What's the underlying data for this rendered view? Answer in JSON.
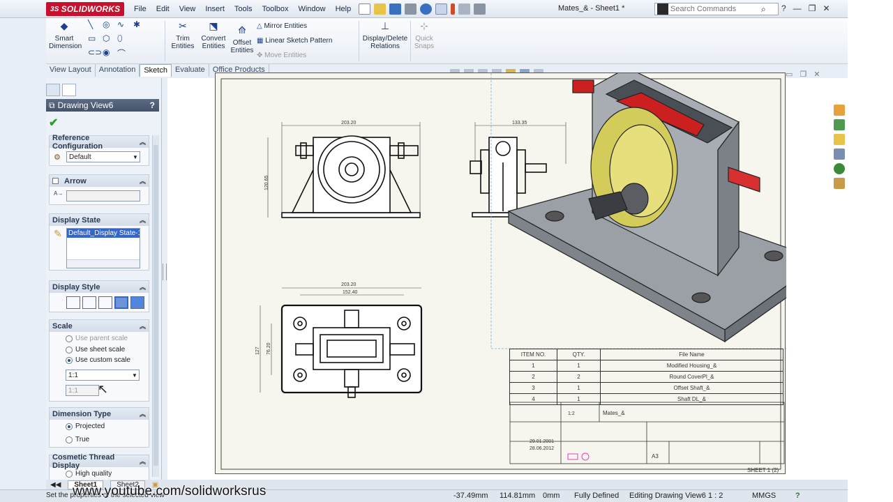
{
  "app": {
    "name": "SOLIDWORKS",
    "document_title": "Mates_& - Sheet1 *",
    "menu": [
      "File",
      "Edit",
      "View",
      "Insert",
      "Tools",
      "Toolbox",
      "Window",
      "Help"
    ],
    "search_placeholder": "Search Commands"
  },
  "commands": {
    "smart_dimension": "Smart Dimension",
    "trim": "Trim Entities",
    "convert": "Convert Entities",
    "offset": "Offset Entities",
    "mirror": "Mirror Entities",
    "linear_pattern": "Linear Sketch Pattern",
    "move": "Move Entities",
    "display_relations": "Display/Delete Relations",
    "quick_snaps": "Quick Snaps"
  },
  "tabs": [
    "View Layout",
    "Annotation",
    "Sketch",
    "Evaluate",
    "Office Products"
  ],
  "active_tab": "Sketch",
  "property_manager": {
    "title": "Drawing View6",
    "help": "?",
    "reference_config": {
      "label": "Reference Configuration",
      "value": "Default"
    },
    "arrow": {
      "label": "Arrow"
    },
    "display_state": {
      "label": "Display State",
      "value": "Default_Display State-1"
    },
    "display_style": {
      "label": "Display Style"
    },
    "scale": {
      "label": "Scale",
      "options": [
        "Use parent scale",
        "Use sheet scale",
        "Use custom scale"
      ],
      "selected": "Use custom scale",
      "value": "1:1",
      "value2": "1:1"
    },
    "dimension_type": {
      "label": "Dimension Type",
      "options": [
        "Projected",
        "True"
      ],
      "selected": "Projected"
    },
    "cosmetic_thread": {
      "label": "Cosmetic Thread Display",
      "options": [
        "High quality"
      ]
    }
  },
  "drawing": {
    "dims": {
      "front_width": "203.20",
      "front_height": "120.65",
      "side_width": "133.35",
      "top_width": "203.20",
      "top_inner": "152.40",
      "top_height": "127",
      "top_inner_h": "76.20"
    },
    "bom": {
      "headers": [
        "ITEM NO.",
        "QTY.",
        "File Name"
      ],
      "rows": [
        [
          "1",
          "1",
          "Modified Housing_&"
        ],
        [
          "2",
          "2",
          "Round CoverPl_&"
        ],
        [
          "3",
          "1",
          "Offset Shaft_&"
        ],
        [
          "4",
          "1",
          "Shaft DL_&"
        ]
      ]
    },
    "title_block": {
      "scale": "1:2",
      "name": "Mates_&",
      "date1": "29.01.2001",
      "date2": "28.06.2012",
      "size": "A3",
      "sheet": "SHEET 1 (2)"
    }
  },
  "sheet_tabs": [
    "Sheet1",
    "Sheet2"
  ],
  "status": {
    "hint": "Set the properties of the selected view",
    "x": "-37.49mm",
    "y": "114.81mm",
    "z": "0mm",
    "state": "Fully Defined",
    "mode": "Editing Drawing View6",
    "scale": "1 : 2",
    "units": "MMGS"
  },
  "watermark": "www.youtube.com/solidworksrus"
}
